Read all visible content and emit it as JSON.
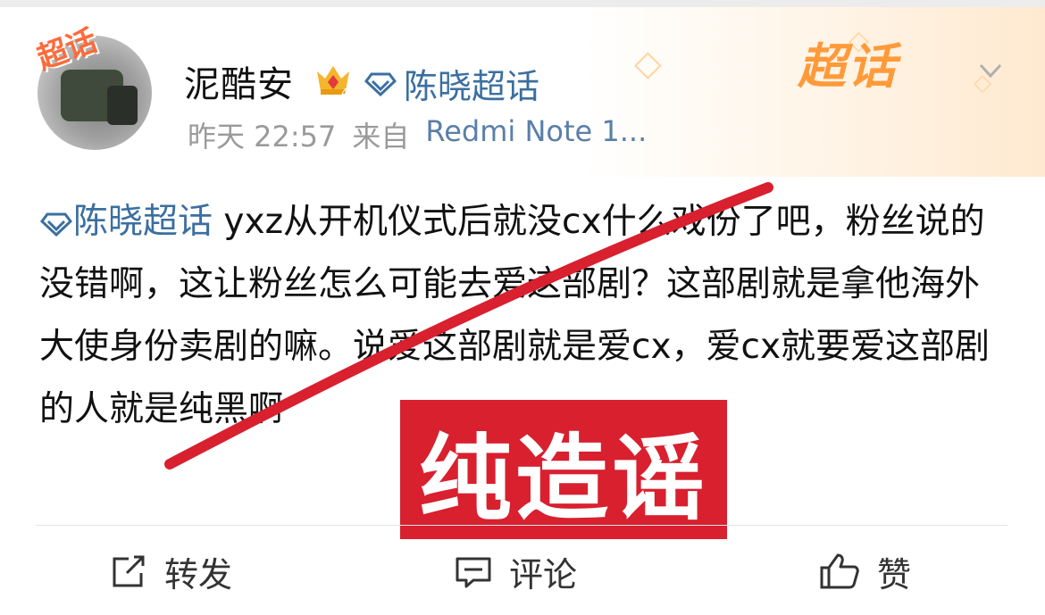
{
  "post": {
    "username": "泥酷安",
    "topic": "陈晓超话",
    "time": "昨天 22:57",
    "source_prefix": "来自",
    "device": "Redmi Note 1...",
    "content_topic": "陈晓超话",
    "content_text": " yxz从开机仪式后就没cx什么戏份了吧，粉丝说的没错啊，这让粉丝怎么可能去爱这部剧？这部剧就是拿他海外大使身份卖剧的嘛。说爱这部剧就是爱cx，爱cx就要爱这部剧的人就是纯黑啊"
  },
  "overlay": {
    "stamp_text": "纯造谣",
    "stamp_color": "#d8202f"
  },
  "header": {
    "supertopic_logo": "超话",
    "avatar_badge": "超话",
    "crown_level": "4"
  },
  "actions": {
    "share": "转发",
    "comment": "评论",
    "like": "赞"
  },
  "colors": {
    "topic_blue": "#3b6fa0",
    "accent_orange": "#ff9a3a"
  },
  "icons": [
    "diamond-icon",
    "crown-icon",
    "share-icon",
    "comment-icon",
    "like-icon",
    "chevron-down-icon"
  ]
}
